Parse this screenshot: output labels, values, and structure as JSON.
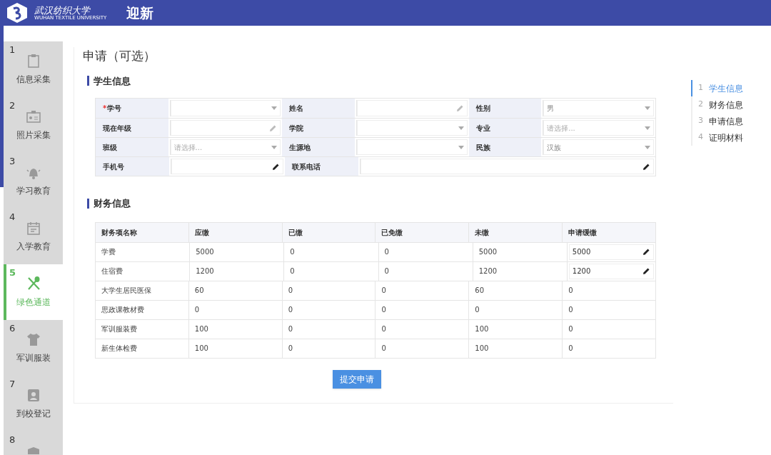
{
  "header": {
    "school_name": "武汉纺织大学",
    "school_name_en": "WUHAN TEXTILE UNIVERSITY",
    "title": "迎新"
  },
  "steps": [
    {
      "number": "1",
      "label": "信息采集",
      "selected": false
    },
    {
      "number": "2",
      "label": "照片采集",
      "selected": false
    },
    {
      "number": "3",
      "label": "学习教育",
      "selected": false
    },
    {
      "number": "4",
      "label": "入学教育",
      "selected": false
    },
    {
      "number": "5",
      "label": "绿色通道",
      "selected": true
    },
    {
      "number": "6",
      "label": "军训服装",
      "selected": false
    },
    {
      "number": "7",
      "label": "到校登记",
      "selected": false
    },
    {
      "number": "8",
      "selected": false
    }
  ],
  "page_title": "申请（可选）",
  "student_section": {
    "title": "学生信息",
    "rows": [
      [
        {
          "label": "学号",
          "required_mark": "*",
          "kind": "select"
        },
        {
          "label": "姓名",
          "kind": "text",
          "disabled": true
        },
        {
          "label": "性别",
          "kind": "select",
          "value": "男"
        }
      ],
      [
        {
          "label": "现在年级",
          "kind": "text",
          "disabled": true
        },
        {
          "label": "学院",
          "kind": "select"
        },
        {
          "label": "专业",
          "kind": "select",
          "placeholder": "请选择..."
        }
      ],
      [
        {
          "label": "班级",
          "kind": "select",
          "placeholder": "请选择..."
        },
        {
          "label": "生源地",
          "kind": "select"
        },
        {
          "label": "民族",
          "kind": "select",
          "value": "汉族"
        }
      ],
      [
        {
          "label": "手机号",
          "kind": "text",
          "disabled": false
        },
        {
          "label": "联系电话",
          "kind": "text",
          "disabled": false
        }
      ]
    ]
  },
  "finance_section": {
    "title": "财务信息",
    "columns": [
      "财务项名称",
      "应缴",
      "已缴",
      "已免缴",
      "未缴",
      "申请缓缴"
    ],
    "rows": [
      {
        "cells": [
          "学费",
          "5000",
          "0",
          "0",
          "5000",
          "5000"
        ],
        "editable": true
      },
      {
        "cells": [
          "住宿费",
          "1200",
          "0",
          "0",
          "1200",
          "1200"
        ],
        "editable": true
      },
      {
        "cells": [
          "大学生居民医保",
          "60",
          "0",
          "0",
          "60",
          "0"
        ],
        "editable": false
      },
      {
        "cells": [
          "思政课教材费",
          "0",
          "0",
          "0",
          "0",
          "0"
        ],
        "editable": false
      },
      {
        "cells": [
          "军训服装费",
          "100",
          "0",
          "0",
          "100",
          "0"
        ],
        "editable": false
      },
      {
        "cells": [
          "新生体检费",
          "100",
          "0",
          "0",
          "100",
          "0"
        ],
        "editable": false
      }
    ]
  },
  "submit_button": "提交申请",
  "anchor_nav": [
    {
      "number": "1",
      "label": "学生信息",
      "selected": true
    },
    {
      "number": "2",
      "label": "财务信息",
      "selected": false
    },
    {
      "number": "3",
      "label": "申请信息",
      "selected": false
    },
    {
      "number": "4",
      "label": "证明材料",
      "selected": false
    }
  ]
}
